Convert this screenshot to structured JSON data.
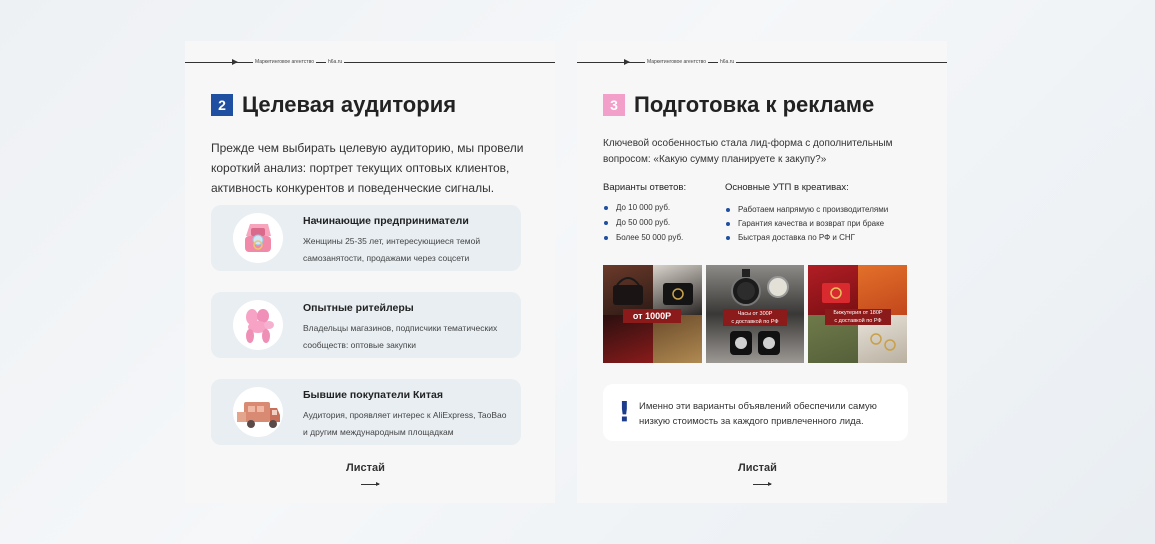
{
  "header": {
    "agency": "Маркетинговое агентство",
    "site": "h6a.ru"
  },
  "colors": {
    "section2_badge": "#1f4fa0",
    "section3_badge": "#f2a0c9",
    "bullet": "#1f4fa0",
    "note_mark": "#1d3c8c",
    "card_item_bg": "#e8eef2"
  },
  "section2": {
    "number": "2",
    "title": "Целевая аудитория",
    "intro": "Прежде чем выбирать целевую аудиторию, мы провели короткий анализ: портрет текущих оптовых клиентов, активность конкурентов и поведенческие сигналы.",
    "audiences": [
      {
        "icon": "jewelry-box-icon",
        "title": "Начинающие предприниматели",
        "desc": "Женщины 25-35 лет, интересующиеся темой самозанятости, продажами через соцсети"
      },
      {
        "icon": "balloon-dog-icon",
        "title": "Опытные ритейлеры",
        "desc": "Владельцы магазинов, подписчики тематических сообществ: оптовые закупки"
      },
      {
        "icon": "delivery-truck-icon",
        "title": "Бывшие покупатели Китая",
        "desc": "Аудитория, проявляет интерес к AliExpress, TaoBao и другим международным площадкам"
      }
    ],
    "scroll_label": "Листай"
  },
  "section3": {
    "number": "3",
    "title": "Подготовка к рекламе",
    "intro": "Ключевой особенностью стала лид-форма с дополнительным вопросом: «Какую сумму планируете к закупу?»",
    "answers_title": "Варианты ответов:",
    "answers": [
      "До 10 000 руб.",
      "До 50 000 руб.",
      "Более 50 000 руб."
    ],
    "usp_title": "Основные УТП в креативах:",
    "usp": [
      "Работаем напрямую с производителями",
      "Гарантия качества и возврат при браке",
      "Быстрая доставка по РФ и СНГ"
    ],
    "creatives": [
      {
        "tag": "от 1000Р"
      },
      {
        "tag_line1": "Часы от 300Р",
        "tag_line2": "с доставкой по РФ"
      },
      {
        "tag_line1": "Бижутерия от 180Р",
        "tag_line2": "с доставкой по РФ"
      }
    ],
    "note": "Именно эти варианты объявлений обеспечили самую низкую стоимость за каждого привлеченного лида.",
    "scroll_label": "Листай"
  }
}
